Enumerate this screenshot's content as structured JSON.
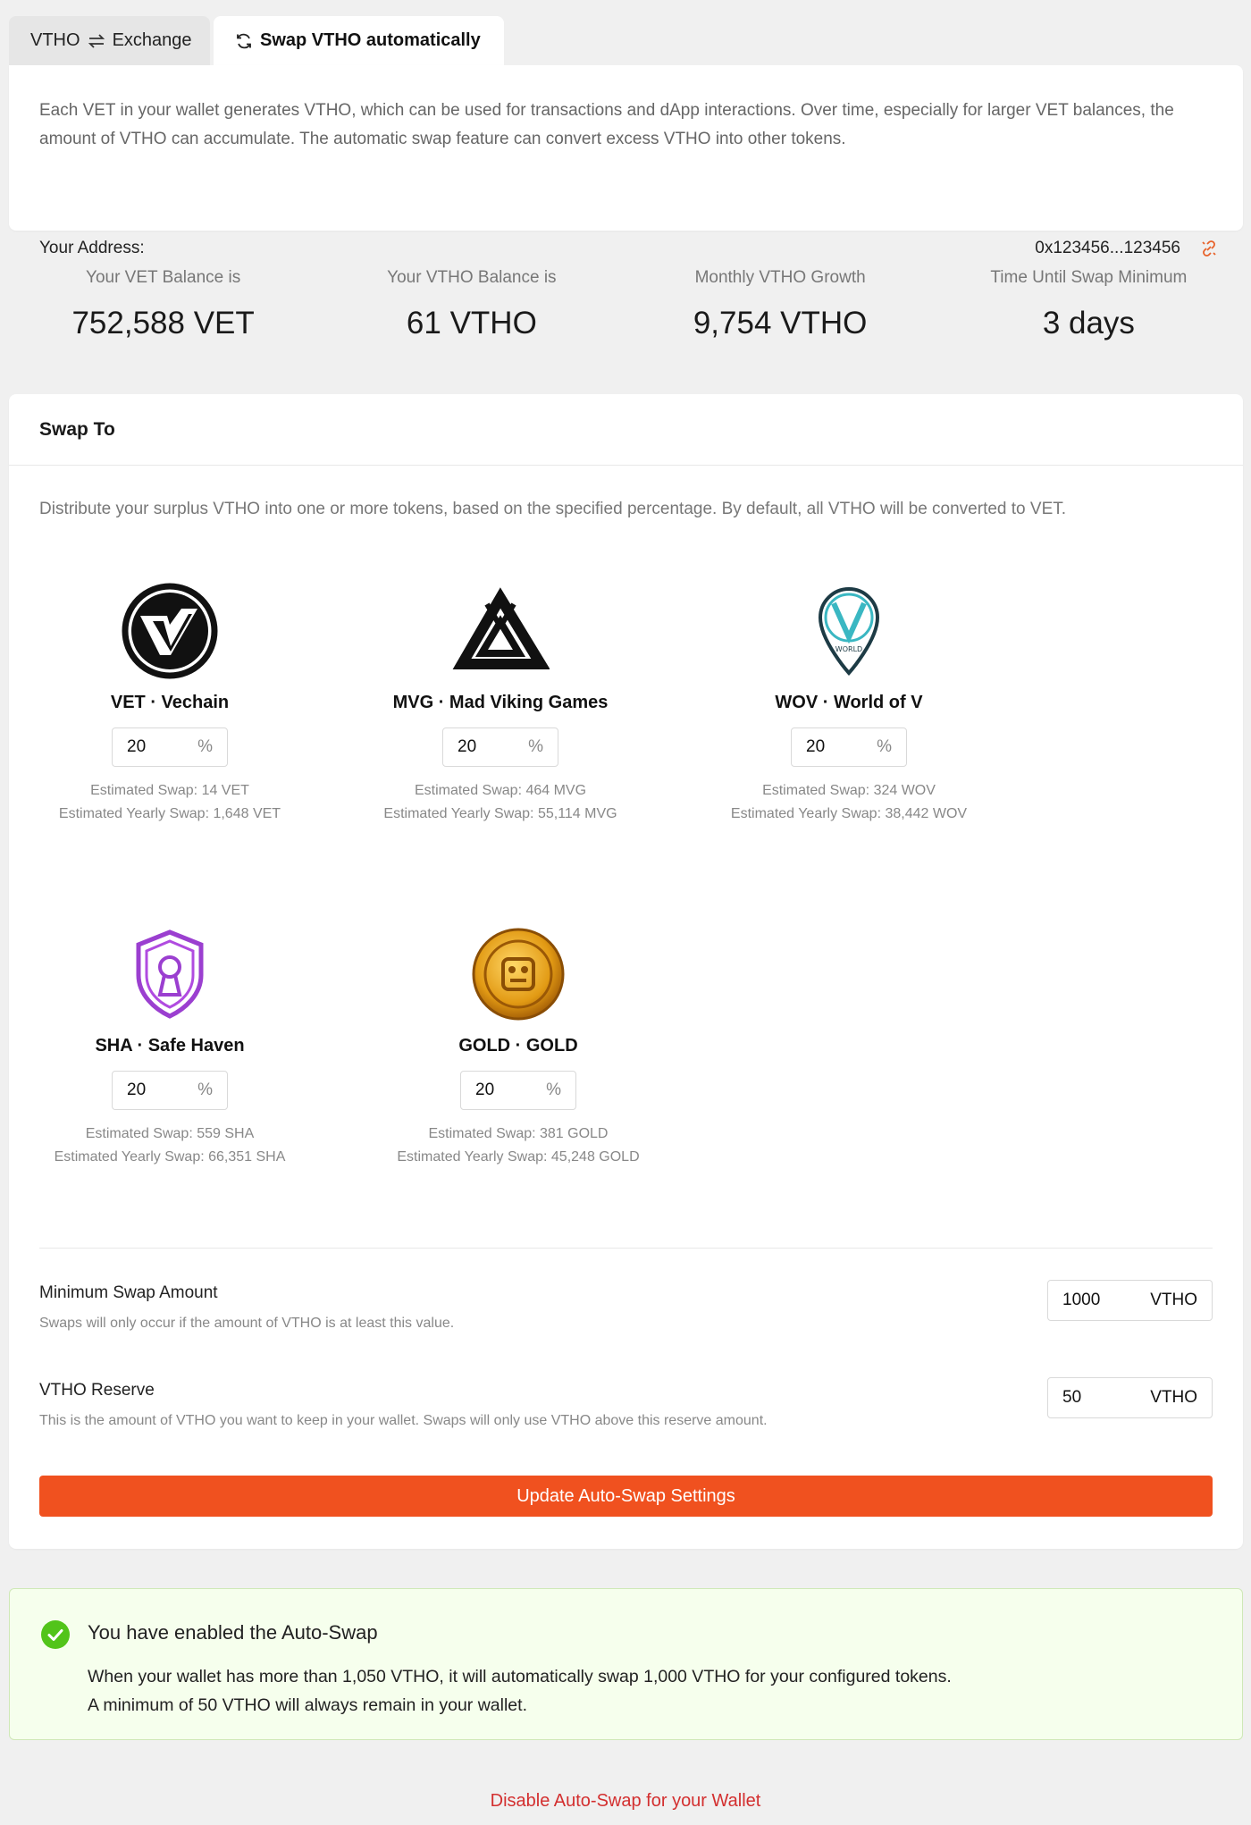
{
  "tabs": [
    {
      "label": "VTHO",
      "icon": "swap-arrows-icon",
      "label2": "Exchange"
    },
    {
      "label": "Swap VTHO automatically",
      "icon": "refresh-icon"
    }
  ],
  "intro": {
    "text": "Each VET in your wallet generates VTHO, which can be used for transactions and dApp interactions. Over time, especially for larger VET balances, the amount of VTHO can accumulate. The automatic swap feature can convert excess VTHO into other tokens.",
    "address_label": "Your Address:",
    "address_value": "0x123456...123456"
  },
  "stats": [
    {
      "label": "Your VET Balance is",
      "value": "752,588 VET"
    },
    {
      "label": "Your VTHO Balance is",
      "value": "61 VTHO"
    },
    {
      "label": "Monthly VTHO Growth",
      "value": "9,754 VTHO"
    },
    {
      "label": "Time Until Swap Minimum",
      "value": "3 days"
    }
  ],
  "swap": {
    "title": "Swap To",
    "description": "Distribute your surplus VTHO into one or more tokens, based on the specified percentage. By default, all VTHO will be converted to VET.",
    "percent_unit": "%",
    "tokens": [
      {
        "name": "VET · Vechain",
        "percent": "20",
        "est": "Estimated Swap: 14 VET",
        "yearly": "Estimated Yearly Swap: 1,648 VET"
      },
      {
        "name": "MVG · Mad Viking Games",
        "percent": "20",
        "est": "Estimated Swap: 464 MVG",
        "yearly": "Estimated Yearly Swap: 55,114 MVG"
      },
      {
        "name": "WOV · World of V",
        "percent": "20",
        "est": "Estimated Swap: 324 WOV",
        "yearly": "Estimated Yearly Swap: 38,442 WOV"
      },
      {
        "name": "SHA · Safe Haven",
        "percent": "20",
        "est": "Estimated Swap: 559 SHA",
        "yearly": "Estimated Yearly Swap: 66,351 SHA"
      },
      {
        "name": "GOLD · GOLD",
        "percent": "20",
        "est": "Estimated Swap: 381 GOLD",
        "yearly": "Estimated Yearly Swap: 45,248 GOLD"
      }
    ],
    "min_swap": {
      "label": "Minimum Swap Amount",
      "help": "Swaps will only occur if the amount of VTHO is at least this value.",
      "value": "1000",
      "unit": "VTHO"
    },
    "reserve": {
      "label": "VTHO Reserve",
      "help": "This is the amount of VTHO you want to keep in your wallet. Swaps will only use VTHO above this reserve amount.",
      "value": "50",
      "unit": "VTHO"
    },
    "update_button": "Update Auto-Swap Settings"
  },
  "success": {
    "title": "You have enabled the Auto-Swap",
    "line1": "When your wallet has more than 1,050 VTHO, it will automatically swap 1,000 VTHO for your configured tokens.",
    "line2": "A minimum of 50 VTHO will always remain in your wallet."
  },
  "disable_link": "Disable Auto-Swap for your Wallet",
  "colors": {
    "accent": "#f0511f",
    "success": "#52c41a",
    "danger": "#d32f2f"
  }
}
